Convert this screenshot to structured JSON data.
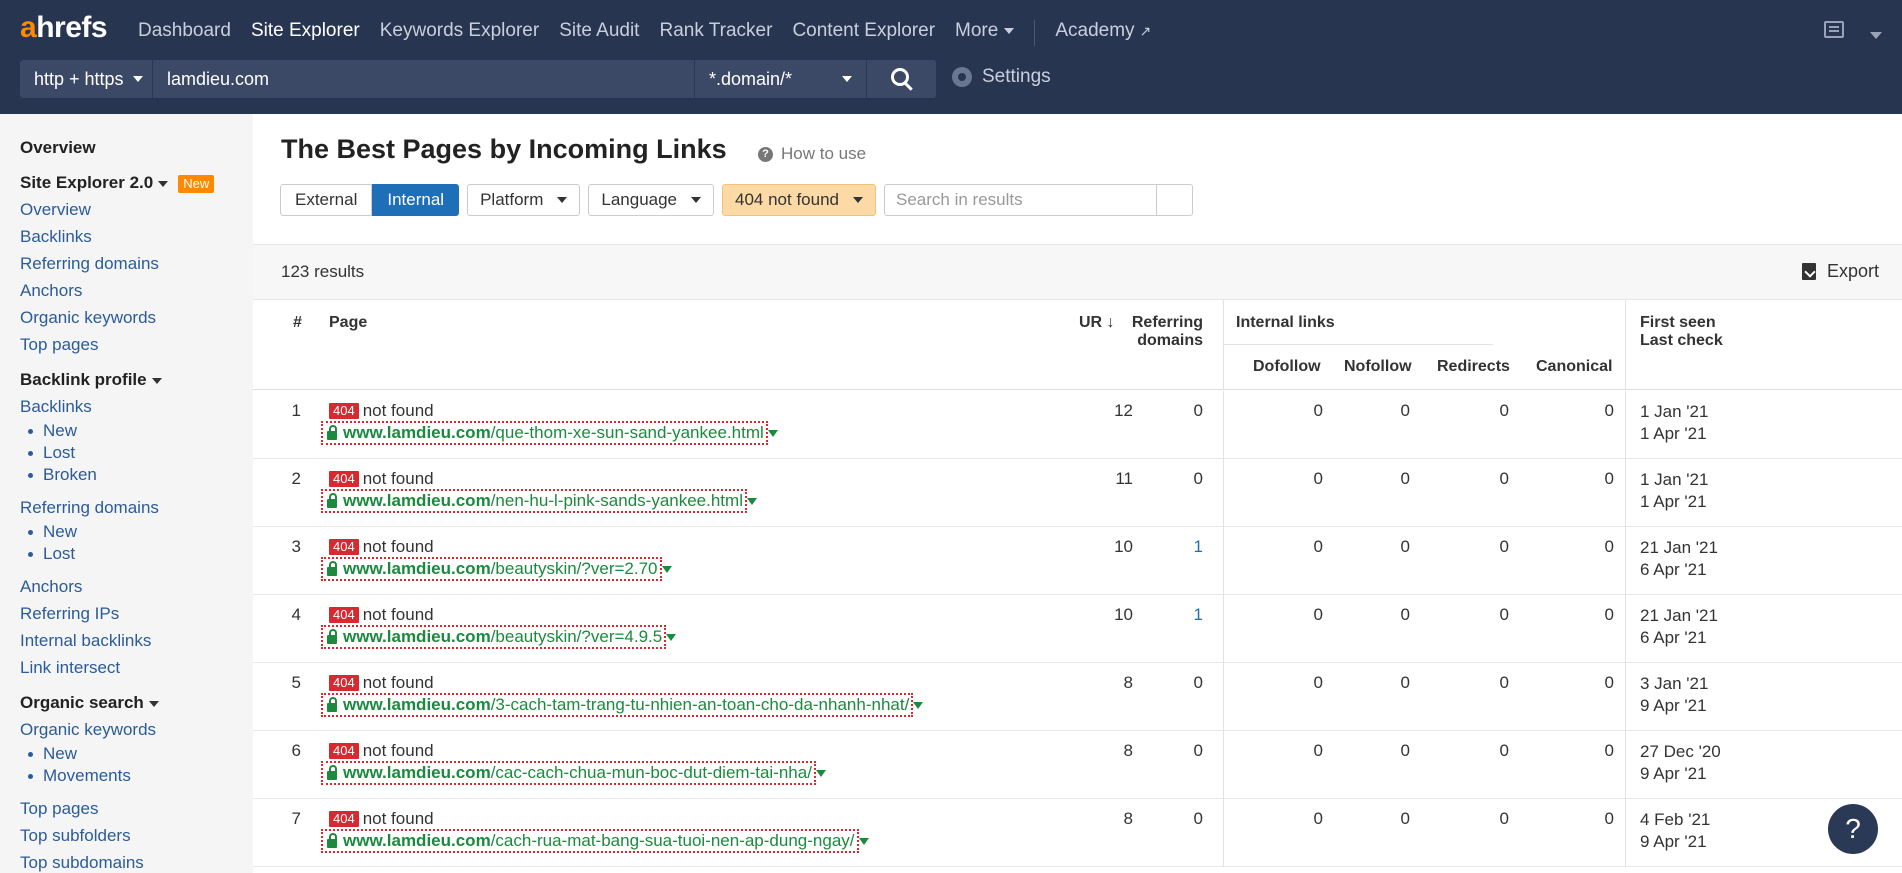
{
  "brand": {
    "a": "a",
    "rest": "hrefs"
  },
  "nav": {
    "items": [
      {
        "label": "Dashboard",
        "active": false
      },
      {
        "label": "Site Explorer",
        "active": true
      },
      {
        "label": "Keywords Explorer",
        "active": false
      },
      {
        "label": "Site Audit",
        "active": false
      },
      {
        "label": "Rank Tracker",
        "active": false
      },
      {
        "label": "Content Explorer",
        "active": false
      }
    ],
    "more": "More",
    "academy": "Academy"
  },
  "search": {
    "protocol": "http + https",
    "target": "lamdieu.com",
    "mode": "*.domain/*"
  },
  "settings": "Settings",
  "sidebar": {
    "overview": "Overview",
    "se2": "Site Explorer 2.0",
    "se2_badge": "New",
    "se2_items": [
      "Overview",
      "Backlinks",
      "Referring domains",
      "Anchors",
      "Organic keywords",
      "Top pages"
    ],
    "backlink_profile": "Backlink profile",
    "backlinks": "Backlinks",
    "backlinks_sub": [
      "New",
      "Lost",
      "Broken"
    ],
    "referring_domains": "Referring domains",
    "rd_sub": [
      "New",
      "Lost"
    ],
    "other_links": [
      "Anchors",
      "Referring IPs",
      "Internal backlinks",
      "Link intersect"
    ],
    "organic_search": "Organic search",
    "organic_keywords": "Organic keywords",
    "ok_sub": [
      "New",
      "Movements"
    ],
    "bottom_links": [
      "Top pages",
      "Top subfolders",
      "Top subdomains"
    ]
  },
  "main": {
    "title": "The Best Pages by Incoming Links",
    "how_to_use": "How to use",
    "filters": {
      "external": "External",
      "internal": "Internal",
      "platform": "Platform",
      "language": "Language",
      "status": "404 not found",
      "search_placeholder": "Search in results"
    },
    "results": "123 results",
    "export": "Export"
  },
  "table": {
    "headers": {
      "num": "#",
      "page": "Page",
      "ur": "UR",
      "ref1": "Referring",
      "ref2": "domains",
      "internal": "Internal links",
      "dofollow": "Dofollow",
      "nofollow": "Nofollow",
      "redirects": "Redirects",
      "canonical": "Canonical",
      "first_seen": "First seen",
      "last_check": "Last check"
    },
    "rows": [
      {
        "n": "1",
        "badge": "404",
        "status": "not found",
        "domain": "www.lamdieu.com",
        "path": "/que-thom-xe-sun-sand-yankee.html",
        "ur": "12",
        "rd": "0",
        "dofollow": "0",
        "nofollow": "0",
        "redirects": "0",
        "canonical": "0",
        "first": "1 Jan '21",
        "last": "1 Apr '21"
      },
      {
        "n": "2",
        "badge": "404",
        "status": "not found",
        "domain": "www.lamdieu.com",
        "path": "/nen-hu-l-pink-sands-yankee.html",
        "ur": "11",
        "rd": "0",
        "dofollow": "0",
        "nofollow": "0",
        "redirects": "0",
        "canonical": "0",
        "first": "1 Jan '21",
        "last": "1 Apr '21"
      },
      {
        "n": "3",
        "badge": "404",
        "status": "not found",
        "domain": "www.lamdieu.com",
        "path": "/beautyskin/?ver=2.70",
        "ur": "10",
        "rd": "1",
        "dofollow": "0",
        "nofollow": "0",
        "redirects": "0",
        "canonical": "0",
        "first": "21 Jan '21",
        "last": "6 Apr '21"
      },
      {
        "n": "4",
        "badge": "404",
        "status": "not found",
        "domain": "www.lamdieu.com",
        "path": "/beautyskin/?ver=4.9.5",
        "ur": "10",
        "rd": "1",
        "dofollow": "0",
        "nofollow": "0",
        "redirects": "0",
        "canonical": "0",
        "first": "21 Jan '21",
        "last": "6 Apr '21"
      },
      {
        "n": "5",
        "badge": "404",
        "status": "not found",
        "domain": "www.lamdieu.com",
        "path": "/3-cach-tam-trang-tu-nhien-an-toan-cho-da-nhanh-nhat/",
        "ur": "8",
        "rd": "0",
        "dofollow": "0",
        "nofollow": "0",
        "redirects": "0",
        "canonical": "0",
        "first": "3 Jan '21",
        "last": "9 Apr '21"
      },
      {
        "n": "6",
        "badge": "404",
        "status": "not found",
        "domain": "www.lamdieu.com",
        "path": "/cac-cach-chua-mun-boc-dut-diem-tai-nha/",
        "ur": "8",
        "rd": "0",
        "dofollow": "0",
        "nofollow": "0",
        "redirects": "0",
        "canonical": "0",
        "first": "27 Dec '20",
        "last": "9 Apr '21"
      },
      {
        "n": "7",
        "badge": "404",
        "status": "not found",
        "domain": "www.lamdieu.com",
        "path": "/cach-rua-mat-bang-sua-tuoi-nen-ap-dung-ngay/",
        "ur": "8",
        "rd": "0",
        "dofollow": "0",
        "nofollow": "0",
        "redirects": "0",
        "canonical": "0",
        "first": "4 Feb '21",
        "last": "9 Apr '21"
      }
    ]
  },
  "help": "?",
  "colors": {
    "topbar": "#283550",
    "brand_accent": "#ff8800",
    "active_filter": "#1f6fb8",
    "badge_404": "#d9282f",
    "url_green": "#1c8a3e",
    "link_blue": "#2a5b9a"
  }
}
